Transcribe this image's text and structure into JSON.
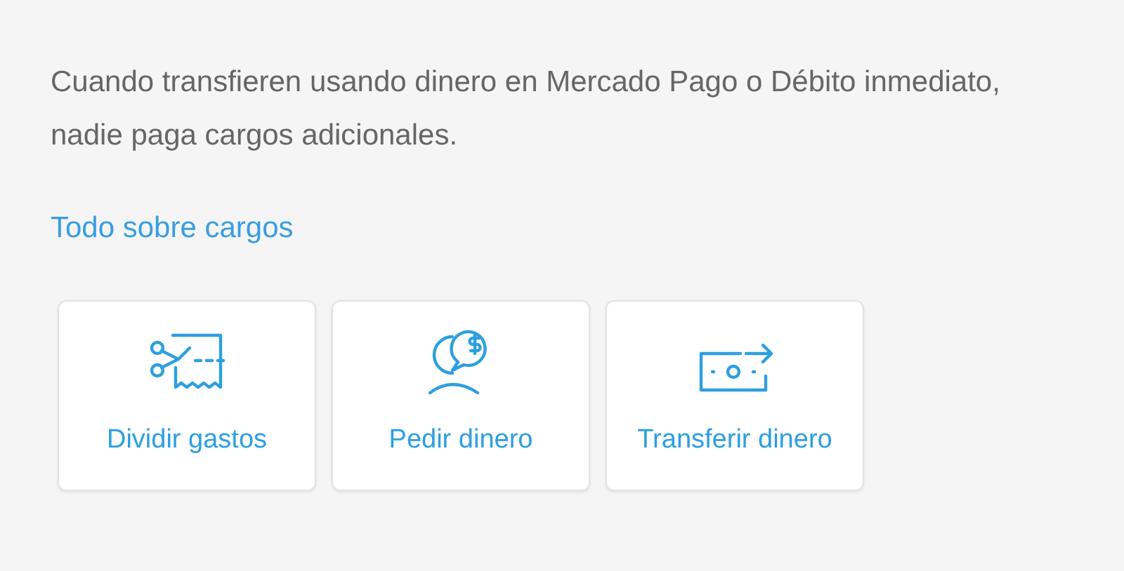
{
  "message": "Cuando transfieren usando dinero en Mercado Pago o Débito inmediato, nadie paga cargos adicionales.",
  "link": "Todo sobre cargos",
  "actions": [
    {
      "kind": "split",
      "label": "Dividir gastos"
    },
    {
      "kind": "request",
      "label": "Pedir dinero"
    },
    {
      "kind": "transfer",
      "label": "Transferir dinero"
    }
  ]
}
